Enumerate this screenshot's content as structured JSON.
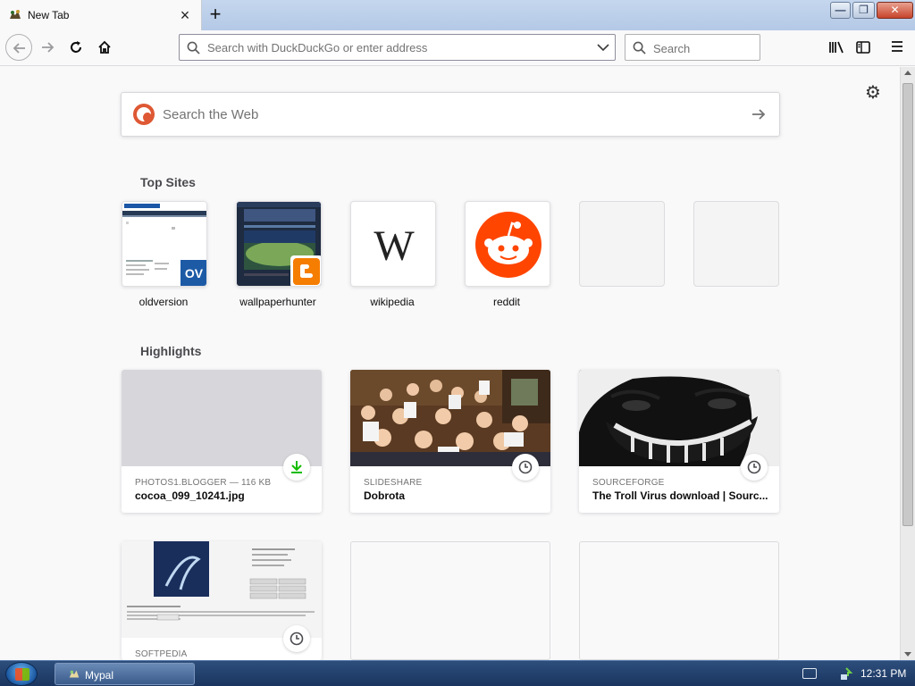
{
  "tab": {
    "title": "New Tab",
    "close_label": "×"
  },
  "new_tab_label": "+",
  "urlbar": {
    "placeholder": "Search with DuckDuckGo or enter address"
  },
  "searchbar": {
    "placeholder": "Search"
  },
  "web_search": {
    "placeholder": "Search the Web"
  },
  "top_sites": {
    "title": "Top Sites",
    "items": [
      {
        "label": "oldversion"
      },
      {
        "label": "wallpaperhunter"
      },
      {
        "label": "wikipedia",
        "logo_text": "W"
      },
      {
        "label": "reddit"
      },
      {
        "label": ""
      },
      {
        "label": ""
      }
    ]
  },
  "highlights": {
    "title": "Highlights",
    "items": [
      {
        "source": "PHOTOS1.BLOGGER — 116 KB",
        "title": "cocoa_099_10241.jpg",
        "badge": "download-icon"
      },
      {
        "source": "SLIDESHARE",
        "title": "Dobrota",
        "badge": "clock-icon"
      },
      {
        "source": "SOURCEFORGE",
        "title": "The Troll Virus download | Sourc...",
        "badge": "clock-icon"
      },
      {
        "source": "SOFTPEDIA",
        "title": "",
        "badge": "clock-icon"
      }
    ]
  },
  "oldversion_badge": "OV",
  "taskbar": {
    "app_label": "Mypal",
    "clock": "12:31 PM"
  },
  "colors": {
    "accent": "#0a84ff",
    "download_green": "#12bc00",
    "reddit": "#ff4500",
    "ddg": "#de5833",
    "blogger": "#f57d00"
  }
}
